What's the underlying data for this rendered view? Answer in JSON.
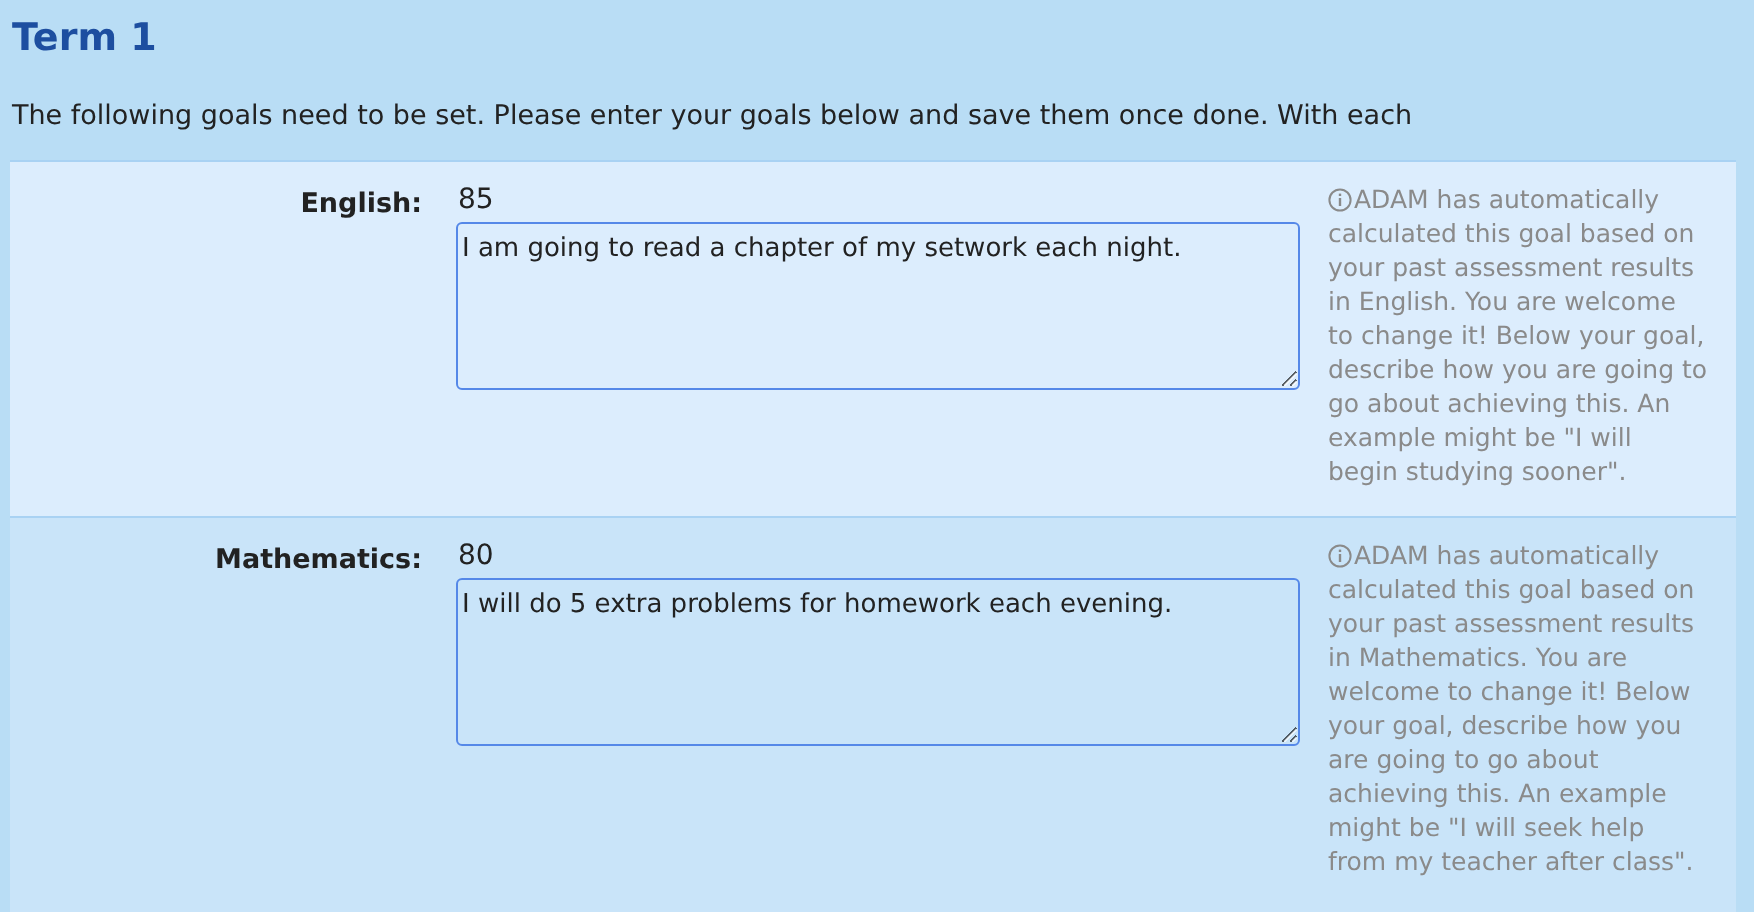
{
  "heading": "Term 1",
  "intro": "The following goals need to be set. Please enter your goals below and save them once done. With each",
  "goals": [
    {
      "subject": "English:",
      "score": "85",
      "goal": "I am going to read a chapter of my setwork each night.",
      "hint": "ADAM has automatically calculated this goal based on your past assessment results in English. You are welcome to change it! Below your goal, describe how you are going to go about achieving this. An example might be \"I will begin studying sooner\"."
    },
    {
      "subject": "Mathematics:",
      "score": "80",
      "goal": "I will do 5 extra problems for homework each evening.",
      "hint": "ADAM has automatically calculated this goal based on your past assessment results in Mathematics. You are welcome to change it! Below your goal, describe how you are going to go about achieving this. An example might be \"I will seek help from my teacher after class\"."
    }
  ]
}
